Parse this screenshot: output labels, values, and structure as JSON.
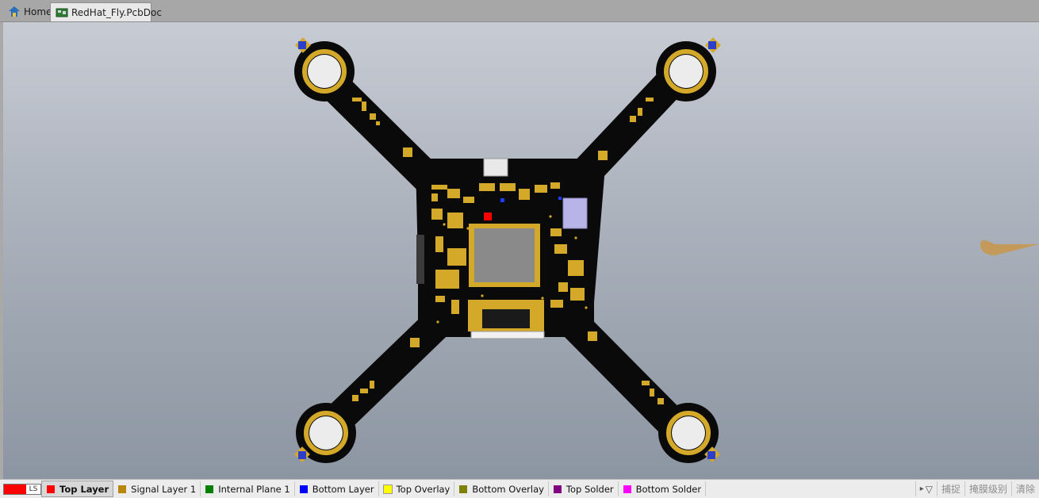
{
  "tabs": [
    {
      "label": "Home",
      "icon": "home-icon"
    },
    {
      "label": "RedHat_Fly.PcbDoc",
      "icon": "pcb-document-icon"
    }
  ],
  "layer_bar": {
    "current_layer_color": "#ff0000",
    "current_layer_code": "LS",
    "layers": [
      {
        "label": "Top Layer",
        "color": "#ff0000"
      },
      {
        "label": "Signal Layer 1",
        "color": "#b8860b"
      },
      {
        "label": "Internal Plane 1",
        "color": "#008000"
      },
      {
        "label": "Bottom Layer",
        "color": "#0000ff"
      },
      {
        "label": "Top Overlay",
        "color": "#ffff00"
      },
      {
        "label": "Bottom Overlay",
        "color": "#808000"
      },
      {
        "label": "Top Solder",
        "color": "#800080"
      },
      {
        "label": "Bottom Solder",
        "color": "#ff00ff"
      }
    ],
    "snap_label": "捕捉",
    "mask_level_label": "掩膜级别",
    "clear_label": "清除"
  },
  "colors": {
    "board": "#0a0a0a",
    "copper": "#d4a92a",
    "mcu_body": "#8a8a8a"
  }
}
